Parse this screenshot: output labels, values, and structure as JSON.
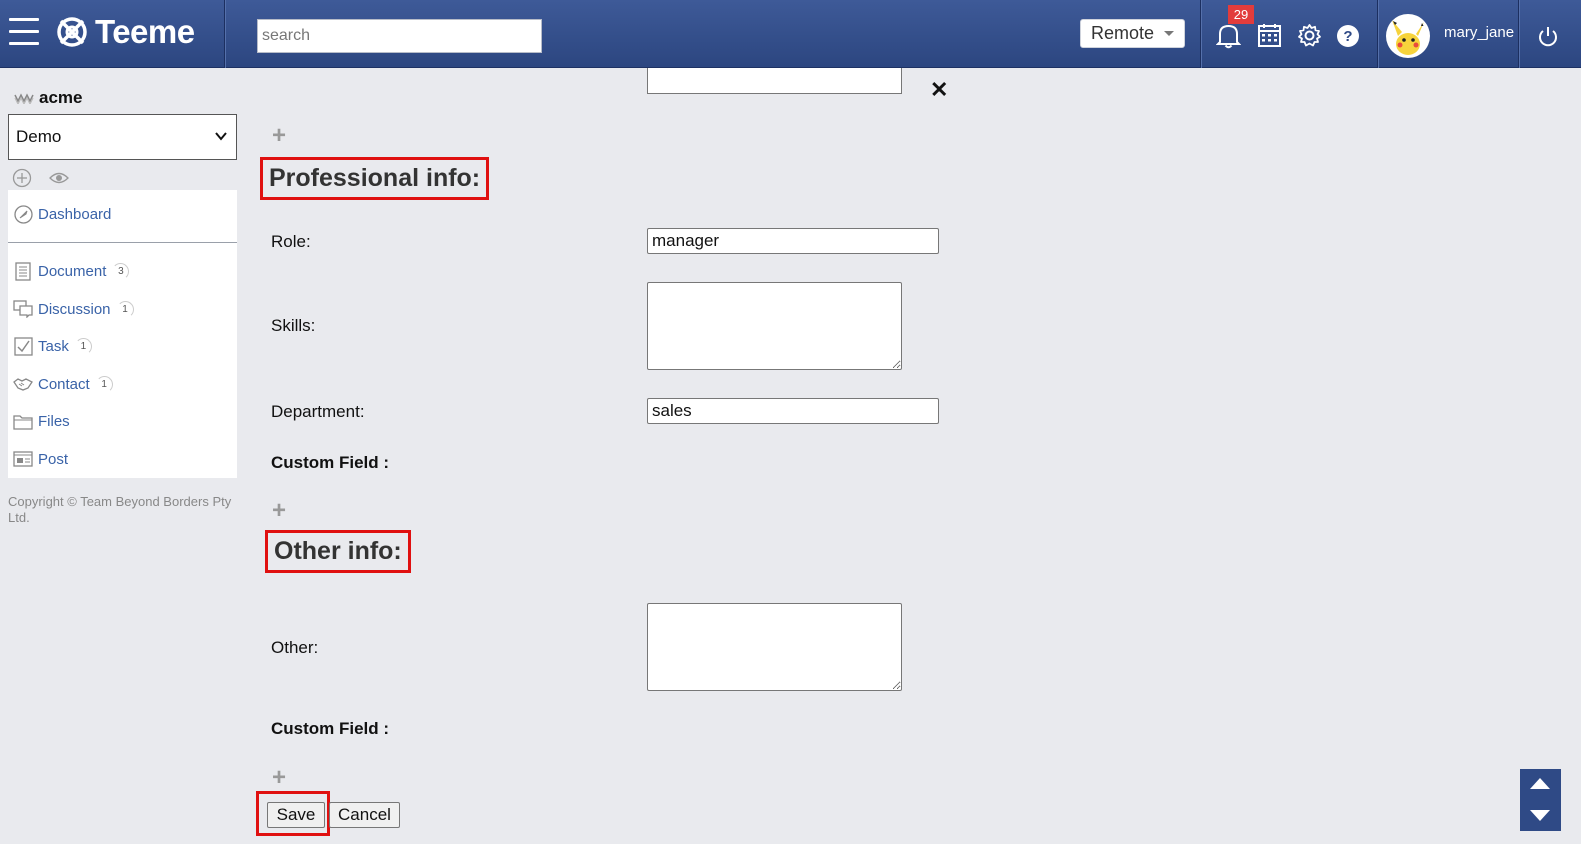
{
  "app": {
    "name": "Teeme"
  },
  "header": {
    "search_placeholder": "search",
    "mode_select": "Remote",
    "notification_count": "29",
    "username": "mary_jane",
    "icons": [
      "menu-icon",
      "bell-icon",
      "calendar-icon",
      "gear-icon",
      "help-icon",
      "power-icon"
    ]
  },
  "sidebar": {
    "org_name": "acme",
    "space_selected": "Demo",
    "items": [
      {
        "label": "Dashboard",
        "icon": "dashboard-icon",
        "count": ""
      },
      {
        "label": "Document",
        "icon": "document-icon",
        "count": "3"
      },
      {
        "label": "Discussion",
        "icon": "discussion-icon",
        "count": "1"
      },
      {
        "label": "Task",
        "icon": "task-icon",
        "count": "1"
      },
      {
        "label": "Contact",
        "icon": "contact-icon",
        "count": "1"
      },
      {
        "label": "Files",
        "icon": "folder-icon",
        "count": ""
      },
      {
        "label": "Post",
        "icon": "post-icon",
        "count": ""
      }
    ],
    "copyright": "Copyright © Team Beyond Borders Pty Ltd."
  },
  "form": {
    "professional": {
      "title": "Professional info:",
      "role_label": "Role:",
      "role_value": "manager",
      "skills_label": "Skills:",
      "skills_value": "",
      "department_label": "Department:",
      "department_value": "sales",
      "custom_field_label": "Custom Field :"
    },
    "other": {
      "title": "Other info:",
      "other_label": "Other:",
      "other_value": "",
      "custom_field_label": "Custom Field :"
    },
    "save_label": "Save",
    "cancel_label": "Cancel",
    "close_symbol": "✕"
  },
  "colors": {
    "header": "#2f4a86",
    "highlight": "#e01010",
    "link": "#3a63a8",
    "badge": "#e23c3c"
  }
}
